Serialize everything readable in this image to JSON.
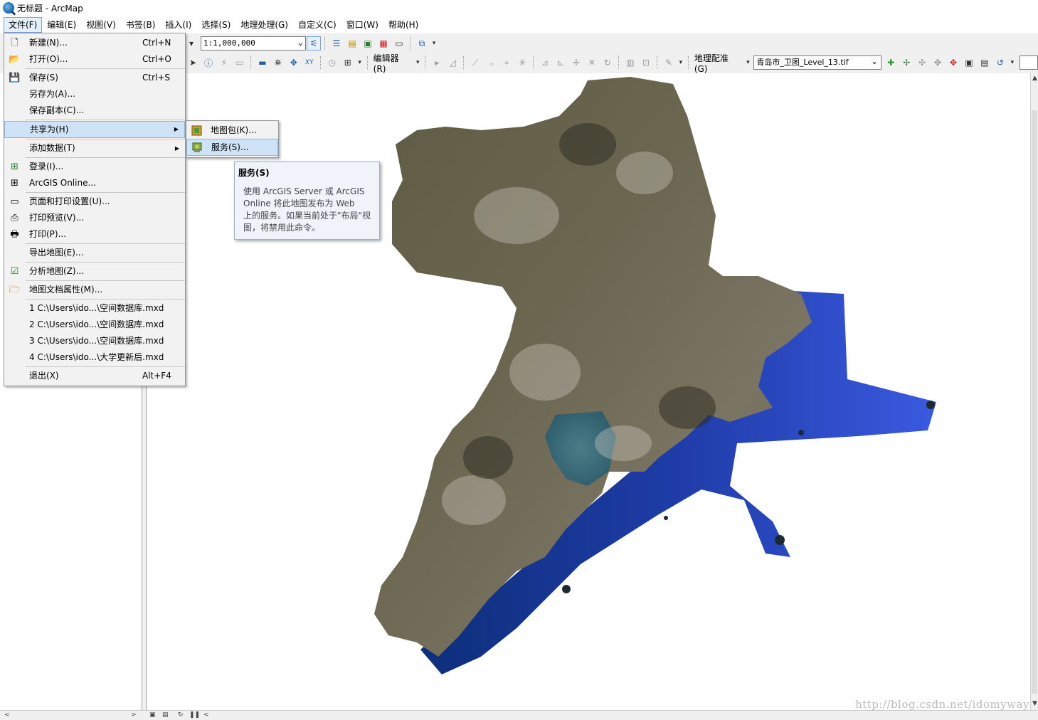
{
  "window": {
    "title": "无标题 - ArcMap"
  },
  "menubar": [
    {
      "label": "文件(F)"
    },
    {
      "label": "编辑(E)"
    },
    {
      "label": "视图(V)"
    },
    {
      "label": "书签(B)"
    },
    {
      "label": "插入(I)"
    },
    {
      "label": "选择(S)"
    },
    {
      "label": "地理处理(G)"
    },
    {
      "label": "自定义(C)"
    },
    {
      "label": "窗口(W)"
    },
    {
      "label": "帮助(H)"
    }
  ],
  "toolbar": {
    "scale_value": "1:1,000,000",
    "editor_label": "编辑器(R)",
    "georef_label": "地理配准(G)",
    "layer_name": "青岛市_卫图_Level_13.tif"
  },
  "file_menu": {
    "items": [
      {
        "label": "新建(N)...",
        "shortcut": "Ctrl+N"
      },
      {
        "label": "打开(O)...",
        "shortcut": "Ctrl+O"
      },
      {
        "label": "保存(S)",
        "shortcut": "Ctrl+S"
      },
      {
        "label": "另存为(A)...",
        "shortcut": ""
      },
      {
        "label": "保存副本(C)...",
        "shortcut": ""
      },
      {
        "label": "共享为(H)",
        "shortcut": ""
      },
      {
        "label": "添加数据(T)",
        "shortcut": ""
      },
      {
        "label": "登录(I)...",
        "shortcut": ""
      },
      {
        "label": "ArcGIS Online...",
        "shortcut": ""
      },
      {
        "label": "页面和打印设置(U)...",
        "shortcut": ""
      },
      {
        "label": "打印预览(V)...",
        "shortcut": ""
      },
      {
        "label": "打印(P)...",
        "shortcut": ""
      },
      {
        "label": "导出地图(E)...",
        "shortcut": ""
      },
      {
        "label": "分析地图(Z)...",
        "shortcut": ""
      },
      {
        "label": "地图文档属性(M)...",
        "shortcut": ""
      },
      {
        "label": "1 C:\\Users\\ido...\\空间数据库.mxd",
        "shortcut": ""
      },
      {
        "label": "2 C:\\Users\\ido...\\空间数据库.mxd",
        "shortcut": ""
      },
      {
        "label": "3 C:\\Users\\ido...\\空间数据库.mxd",
        "shortcut": ""
      },
      {
        "label": "4 C:\\Users\\ido...\\大学更新后.mxd",
        "shortcut": ""
      },
      {
        "label": "退出(X)",
        "shortcut": "Alt+F4"
      }
    ]
  },
  "share_submenu": {
    "items": [
      {
        "label": "地图包(K)..."
      },
      {
        "label": "服务(S)..."
      }
    ]
  },
  "tooltip": {
    "title": "服务(S)",
    "lines": [
      "使用 ArcGIS Server 或 ArcGIS",
      "Online 将此地图发布为 Web",
      "上的服务。如果当前处于\"布局\"视",
      "图，将禁用此命令。"
    ]
  },
  "watermark": "http://blog.csdn.net/idomyway",
  "colors": {
    "menu_hover": "#cfe3f7",
    "menu_hover_border": "#8eb6e0",
    "sea_blue": "#2f48c8"
  }
}
